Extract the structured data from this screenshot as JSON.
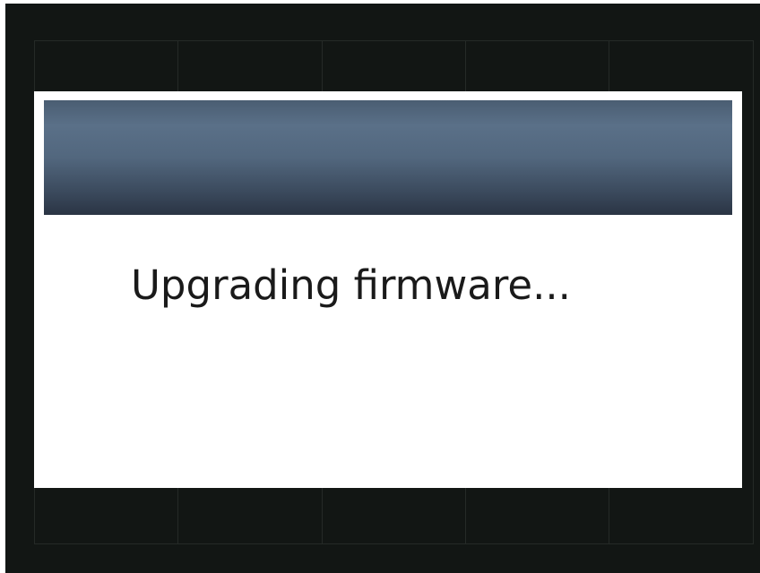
{
  "dialog": {
    "title": "",
    "message": "Upgrading firmware..."
  },
  "colors": {
    "background": "#121614",
    "dialog_background": "#ffffff",
    "header_gradient_top": "#4a5d72",
    "header_gradient_mid": "#5a7088",
    "header_gradient_bottom": "#2a3444",
    "message_text": "#1a1a1a"
  }
}
